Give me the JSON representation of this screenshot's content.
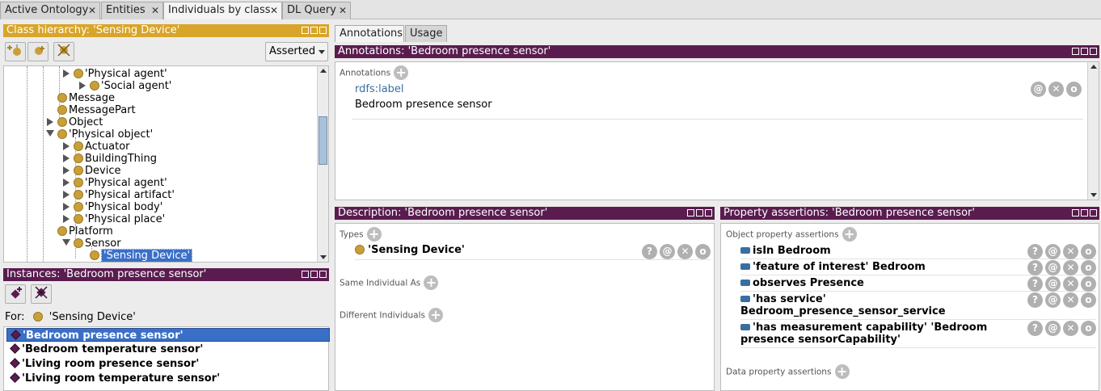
{
  "tabs": [
    {
      "label": "Active Ontology"
    },
    {
      "label": "Entities"
    },
    {
      "label": "Individuals by class",
      "active": true
    },
    {
      "label": "DL Query"
    }
  ],
  "tab_close": "✕",
  "class_hierarchy": {
    "title": "Class hierarchy: 'Sensing Device'",
    "mode": "Asserted",
    "nodes": [
      {
        "label": "'Physical agent'",
        "expand": "collapsed"
      },
      {
        "label": "'Social agent'",
        "expand": "collapsed"
      },
      {
        "label": "Message",
        "expand": "none"
      },
      {
        "label": "MessagePart",
        "expand": "none"
      },
      {
        "label": "Object",
        "expand": "collapsed"
      },
      {
        "label": "'Physical object'",
        "expand": "expanded"
      },
      {
        "label": "Actuator",
        "expand": "collapsed"
      },
      {
        "label": "BuildingThing",
        "expand": "collapsed"
      },
      {
        "label": "Device",
        "expand": "collapsed"
      },
      {
        "label": "'Physical agent'",
        "expand": "collapsed"
      },
      {
        "label": "'Physical artifact'",
        "expand": "collapsed"
      },
      {
        "label": "'Physical body'",
        "expand": "collapsed"
      },
      {
        "label": "'Physical place'",
        "expand": "collapsed"
      },
      {
        "label": "Platform",
        "expand": "none"
      },
      {
        "label": "Sensor",
        "expand": "expanded"
      },
      {
        "label": "'Sensing Device'",
        "expand": "none",
        "selected": true
      }
    ]
  },
  "instances": {
    "title": "Instances: 'Bedroom presence sensor'",
    "for_label": "For:",
    "for_class": "'Sensing Device'",
    "items": [
      {
        "label": "'Bedroom presence sensor'",
        "selected": true
      },
      {
        "label": "'Bedroom temperature sensor'"
      },
      {
        "label": "'Living room presence sensor'"
      },
      {
        "label": "'Living room temperature sensor'"
      }
    ]
  },
  "right_tabs": [
    {
      "label": "Annotations",
      "active": true
    },
    {
      "label": "Usage"
    }
  ],
  "annotations": {
    "title": "Annotations: 'Bedroom presence sensor'",
    "section": "Annotations",
    "property": "rdfs:label",
    "value": "Bedroom presence sensor"
  },
  "description": {
    "title": "Description: 'Bedroom presence sensor'",
    "types_label": "Types",
    "type_value": "'Sensing Device'",
    "same_label": "Same Individual As",
    "different_label": "Different Individuals"
  },
  "property_assertions": {
    "title": "Property assertions: 'Bedroom presence sensor'",
    "object_label": "Object property assertions",
    "data_label": "Data property assertions",
    "rows": [
      {
        "prop": "isIn",
        "value": "Bedroom"
      },
      {
        "prop": "'feature of interest'",
        "value": "Bedroom"
      },
      {
        "prop": "observes",
        "value": "Presence"
      },
      {
        "prop": "'has service'",
        "value": "Bedroom_presence_sensor_service"
      },
      {
        "prop": "'has measurement  capability'",
        "value": "'Bedroom presence sensorCapability'"
      }
    ]
  },
  "glyphs": {
    "plus": "+",
    "question": "?",
    "at": "@",
    "delete": "✕",
    "circle": "o"
  },
  "colors": {
    "gold_header": "#d8a52a",
    "purple_header": "#5a1c4f",
    "selection": "#3a6fc8",
    "class_dot": "#c9a038",
    "individual": "#5a1c4f",
    "link": "#3a6ea0"
  }
}
